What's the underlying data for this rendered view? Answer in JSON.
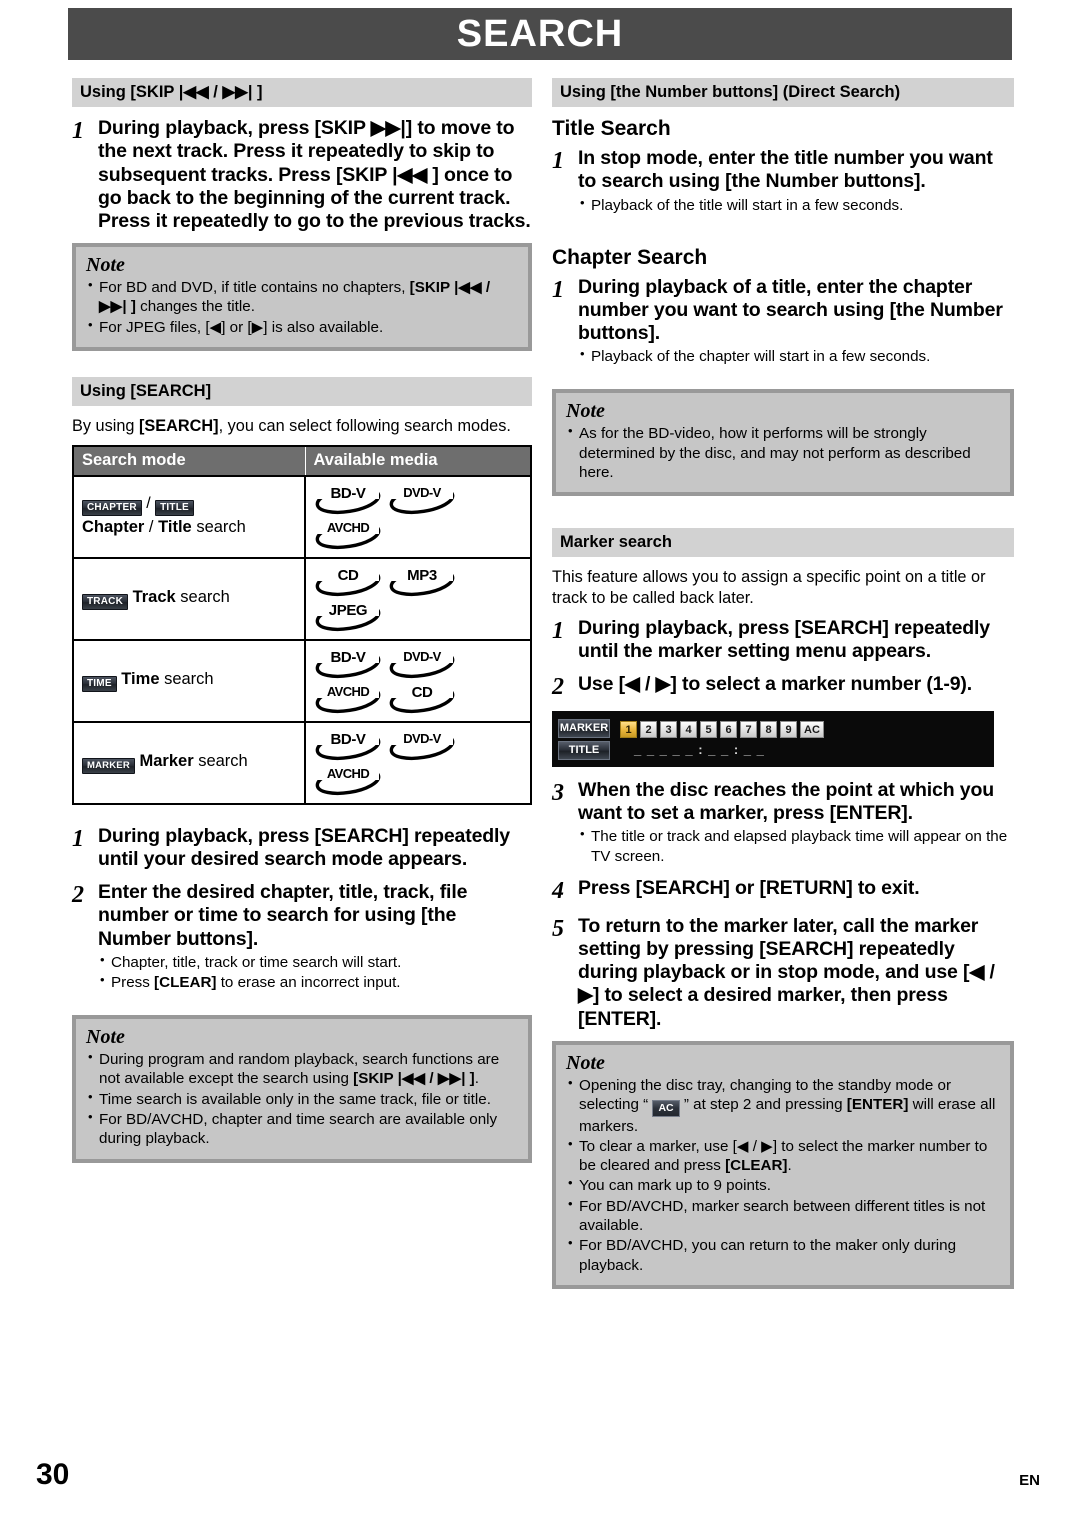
{
  "title_banner": {
    "text": "SEARCH"
  },
  "footer": {
    "page_number": "30",
    "language": "EN"
  },
  "left_column": {
    "section_skip": {
      "header": "Using [SKIP |◀◀ / ▶▶| ]",
      "step1_num": "1",
      "step1_text": "During playback, press [SKIP ▶▶|] to move to the next track. Press it repeatedly to skip to subsequent tracks. Press [SKIP |◀◀ ] once to go back to the beginning of the current track. Press it repeatedly to go to the previous tracks.",
      "note_label": "Note",
      "note_bullet_1a": "For BD and DVD, if title contains no chapters,",
      "note_bullet_1b_bold": "[SKIP |◀◀ / ▶▶| ]",
      "note_bullet_1c": " changes the title.",
      "note_bullet_2": "For JPEG files, [◀] or [▶] is also available."
    },
    "section_search": {
      "header": "Using [SEARCH]",
      "intro_a": "By using ",
      "intro_bold": "[SEARCH]",
      "intro_b": ", you can select following search modes.",
      "table": {
        "columns": [
          "Search mode",
          "Available media"
        ],
        "rows": [
          {
            "tags": [
              "CHAPTER",
              "TITLE"
            ],
            "tag_separator": " / ",
            "label_bold_1": "Chapter",
            "label_mid": " / ",
            "label_bold_2": "Title",
            "label_tail": " search",
            "media": [
              "BD-V",
              "DVD-V",
              "AVCHD"
            ]
          },
          {
            "tags": [
              "TRACK"
            ],
            "label_bold_1": "Track",
            "label_tail": " search",
            "media": [
              "CD",
              "MP3",
              "JPEG"
            ]
          },
          {
            "tags": [
              "TIME"
            ],
            "label_bold_1": "Time",
            "label_tail": " search",
            "media": [
              "BD-V",
              "DVD-V",
              "AVCHD",
              "CD"
            ]
          },
          {
            "tags": [
              "MARKER"
            ],
            "label_bold_1": "Marker",
            "label_tail": " search",
            "media": [
              "BD-V",
              "DVD-V",
              "AVCHD"
            ]
          }
        ]
      },
      "step1_num": "1",
      "step1_text": "During playback, press [SEARCH] repeatedly until your desired search mode appears.",
      "step2_num": "2",
      "step2_text": "Enter the desired chapter, title, track, file number or time to search for using [the Number buttons].",
      "step2_bullet_1": "Chapter, title, track or time search will start.",
      "step2_bullet_2a": "Press ",
      "step2_bullet_2_bold": "[CLEAR]",
      "step2_bullet_2b": " to erase an incorrect input.",
      "note_label": "Note",
      "note_bullet_1a": "During program and random playback, search functions are not available except the search using ",
      "note_bullet_1_bold": "[SKIP |◀◀ / ▶▶| ]",
      "note_bullet_1b": ".",
      "note_bullet_2": "Time search is available only in the same track, file or title.",
      "note_bullet_3": "For BD/AVCHD, chapter and time search are available only during playback."
    }
  },
  "right_column": {
    "section_number_buttons": {
      "header": "Using [the Number buttons] (Direct Search)",
      "title_search": {
        "subhead": "Title Search",
        "step1_num": "1",
        "step1_text": "In stop mode, enter the title number you want to search using [the Number buttons].",
        "bullet_1": "Playback of the title will start in a few seconds."
      },
      "chapter_search": {
        "subhead": "Chapter Search",
        "step1_num": "1",
        "step1_text": "During playback of a title, enter the chapter number you want to search using [the Number buttons].",
        "bullet_1": "Playback of the chapter will start in a few seconds."
      },
      "note_label": "Note",
      "note_bullet_1": "As for the BD-video, how it performs will be strongly determined by the disc, and may not perform as described here."
    },
    "section_marker": {
      "header": "Marker search",
      "intro": "This feature allows you to assign a specific point on a title or track to be called back later.",
      "step1_num": "1",
      "step1_text": "During playback, press [SEARCH] repeatedly until the marker setting menu appears.",
      "step2_num": "2",
      "step2_text": "Use [◀ / ▶] to select a marker number (1-9).",
      "osd": {
        "row1_tag": "MARKER",
        "row2_tag": "TITLE",
        "numbers": [
          "1",
          "2",
          "3",
          "4",
          "5",
          "6",
          "7",
          "8",
          "9",
          "AC"
        ],
        "selected_index": 0,
        "time_display": "_ _ _   _ _ : _ _ : _ _"
      },
      "step3_num": "3",
      "step3_text": "When the disc reaches the point at which you want to set a marker, press [ENTER].",
      "step3_bullet_1": "The title or track and elapsed playback time will appear on the TV screen.",
      "step4_num": "4",
      "step4_text": "Press [SEARCH] or [RETURN] to exit.",
      "step5_num": "5",
      "step5_text": "To return to the marker later, call the marker setting by pressing [SEARCH] repeatedly during playback or in stop mode, and use [◀ / ▶] to select a desired marker, then press [ENTER].",
      "note_label": "Note",
      "note_bullet_1a": "Opening the disc tray, changing to the standby mode or selecting “ ",
      "note_bullet_1_badge": "AC",
      "note_bullet_1b": " ” at step 2 and pressing ",
      "note_bullet_1_bold": "[ENTER]",
      "note_bullet_1c": " will erase all markers.",
      "note_bullet_2a": "To clear a marker, use [◀ / ▶] to select the marker number to be cleared and press ",
      "note_bullet_2_bold": "[CLEAR]",
      "note_bullet_2b": ".",
      "note_bullet_3": "You can mark up to 9 points.",
      "note_bullet_4": "For BD/AVCHD, marker search between different titles is not available.",
      "note_bullet_5": "For BD/AVCHD, you can return to the maker only during playback."
    }
  },
  "colors": {
    "banner_bg": "#4b4b4b",
    "section_header_bg": "#d2d2d2",
    "note_bg": "#c6c6c6",
    "note_border": "#999999",
    "table_header_bg": "#6e6e6e",
    "osd_bg": "#0a0a0a",
    "osd_selected": "#e8b53c"
  }
}
